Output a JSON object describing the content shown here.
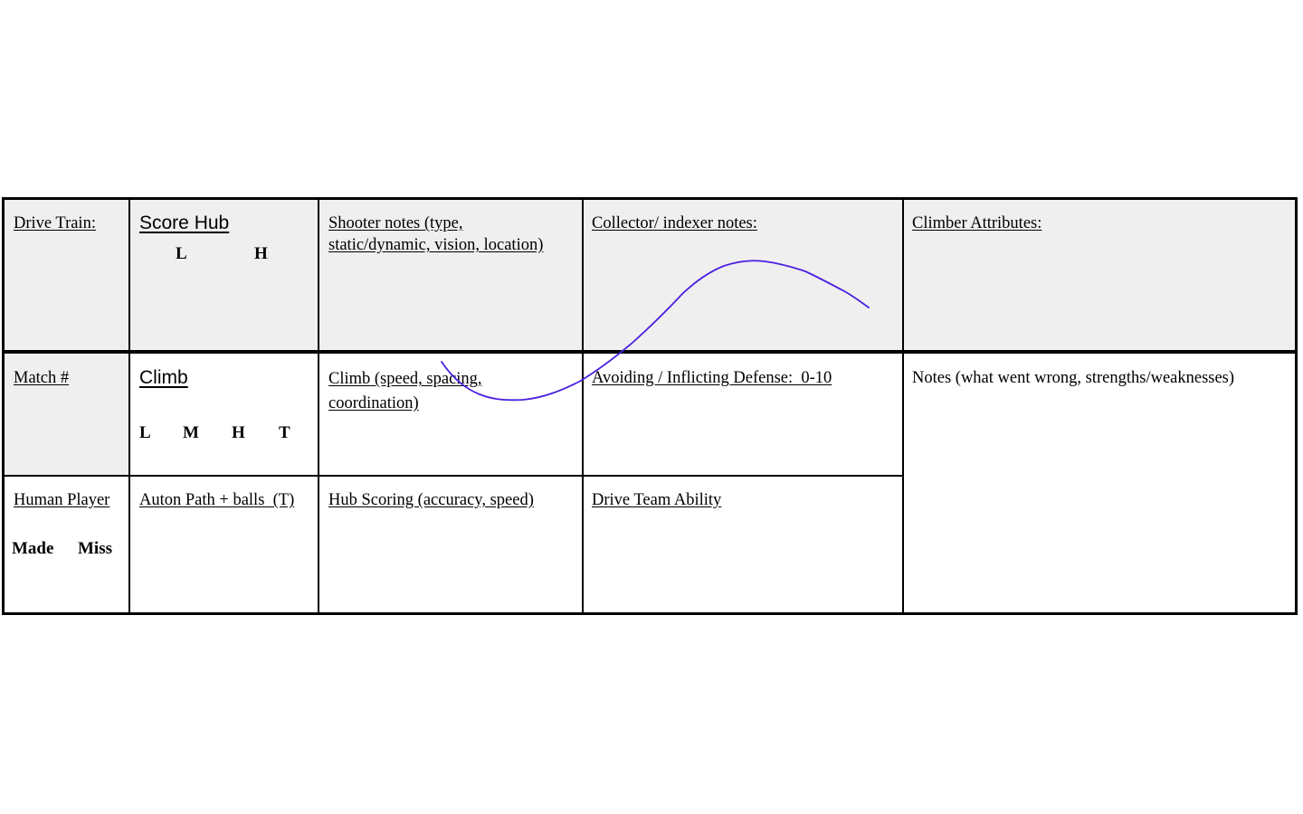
{
  "table": {
    "header_row": {
      "drive_train": "Drive Train:",
      "score_hub": {
        "label": "Score Hub",
        "options": [
          "L",
          "H"
        ]
      },
      "shooter_notes": "Shooter notes (type, static/dynamic, vision, location)",
      "collector_notes": "Collector/ indexer notes:",
      "climber_attributes": "Climber Attributes:"
    },
    "row2": {
      "match_number": "Match #",
      "climb": {
        "label": "Climb",
        "options": [
          "L",
          "M",
          "H",
          "T"
        ]
      },
      "climb_details": "Climb (speed, spacing, coordination)",
      "defense": "Avoiding / Inflicting Defense:  0-10",
      "notes": "Notes (what went wrong, strengths/weaknesses)"
    },
    "row3": {
      "human_player": {
        "label": "Human Player",
        "options": [
          "Made",
          "Miss"
        ]
      },
      "auton": "Auton Path + balls  (T)",
      "hub_scoring": "Hub Scoring (accuracy, speed)",
      "drive_team": "Drive Team Ability"
    }
  },
  "colors": {
    "header_shade": "#efefef",
    "ink_stroke": "#4a1fe0"
  }
}
